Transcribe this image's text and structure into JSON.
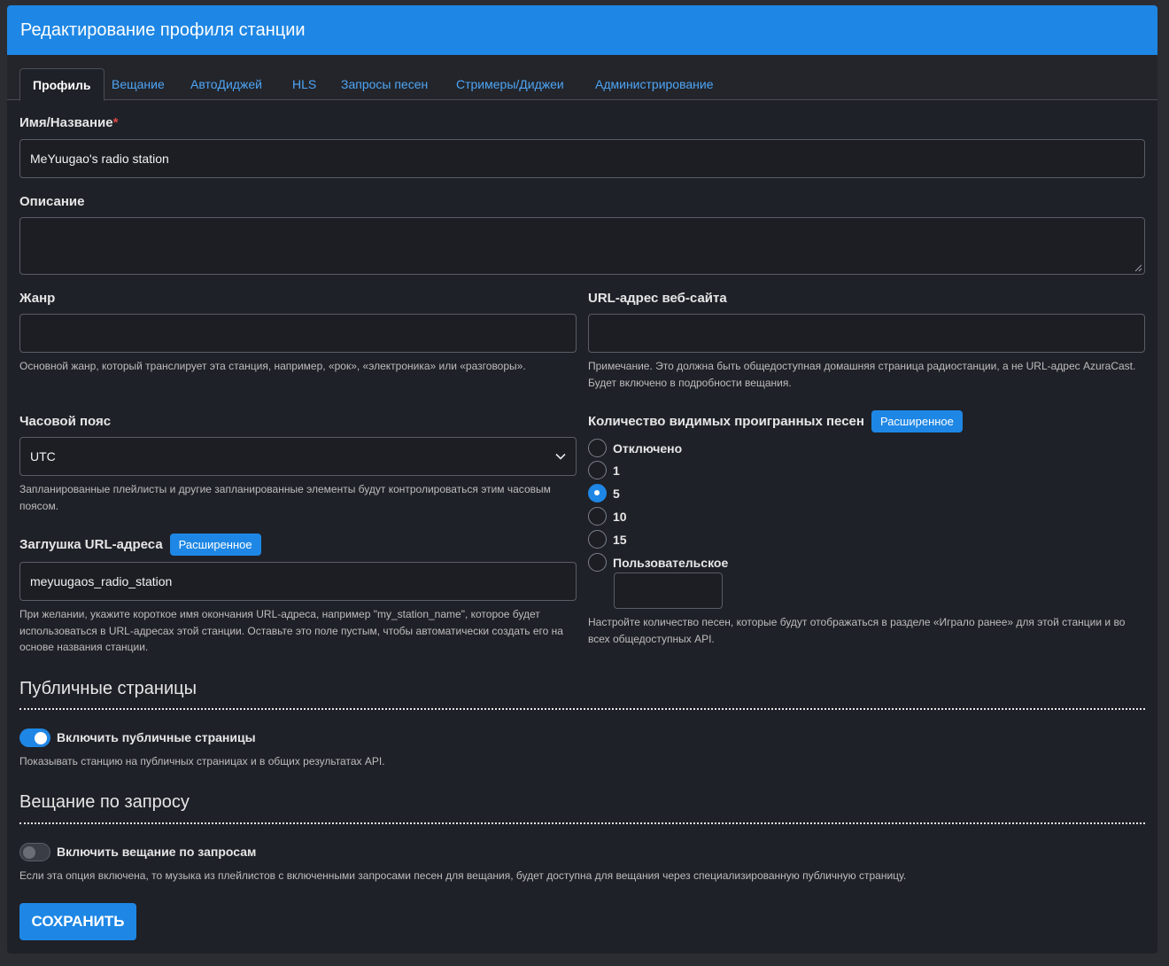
{
  "header": {
    "title": "Редактирование профиля станции"
  },
  "tabs": [
    {
      "label": "Профиль",
      "active": true
    },
    {
      "label": "Вещание"
    },
    {
      "label": "АвтоДиджей"
    },
    {
      "label": "HLS"
    },
    {
      "label": "Запросы песен"
    },
    {
      "label": "Стримеры/Диджеи"
    },
    {
      "label": "Администрирование"
    }
  ],
  "form": {
    "name": {
      "label": "Имя/Название",
      "required_mark": "*",
      "value": "MeYuugao's radio station"
    },
    "description": {
      "label": "Описание",
      "value": ""
    },
    "genre": {
      "label": "Жанр",
      "value": "",
      "help": "Основной жанр, который транслирует эта станция, например, «рок», «электроника» или «разговоры»."
    },
    "website": {
      "label": "URL-адрес веб-сайта",
      "value": "",
      "help": "Примечание. Это должна быть общедоступная домашняя страница радиостанции, а не URL-адрес AzuraCast. Будет включено в подробности вещания."
    },
    "timezone": {
      "label": "Часовой пояс",
      "value": "UTC",
      "help": "Запланированные плейлисты и другие запланированные элементы будут контролироваться этим часовым поясом."
    },
    "short_name": {
      "label": "Заглушка URL-адреса",
      "badge": "Расширенное",
      "value": "meyuugaos_radio_station",
      "help": "При желании, укажите короткое имя окончания URL-адреса, например \"my_station_name\", которое будет использоваться в URL-адресах этой станции. Оставьте это поле пустым, чтобы автоматически создать его на основе названия станции."
    },
    "history": {
      "label": "Количество видимых проигранных песен",
      "badge": "Расширенное",
      "options": [
        {
          "label": "Отключено",
          "checked": false
        },
        {
          "label": "1",
          "checked": false
        },
        {
          "label": "5",
          "checked": true
        },
        {
          "label": "10",
          "checked": false
        },
        {
          "label": "15",
          "checked": false
        },
        {
          "label": "Пользовательское",
          "checked": false
        }
      ],
      "custom_value": "",
      "help": "Настройте количество песен, которые будут отображаться в разделе «Играло ранее» для этой станции и во всех общедоступных API."
    }
  },
  "public_pages": {
    "title": "Публичные страницы",
    "toggle_label": "Включить публичные страницы",
    "enabled": true,
    "help": "Показывать станцию на публичных страницах и в общих результатах API."
  },
  "on_demand": {
    "title": "Вещание по запросу",
    "toggle_label": "Включить вещание по запросам",
    "enabled": false,
    "help": "Если эта опция включена, то музыка из плейлистов с включенными запросами песен для вещания, будет доступна для вещания через специализированную публичную страницу."
  },
  "actions": {
    "save_label": "СОХРАНИТЬ"
  },
  "colors": {
    "accent": "#1e87e5",
    "background": "#1f2128",
    "required": "#e04848"
  }
}
